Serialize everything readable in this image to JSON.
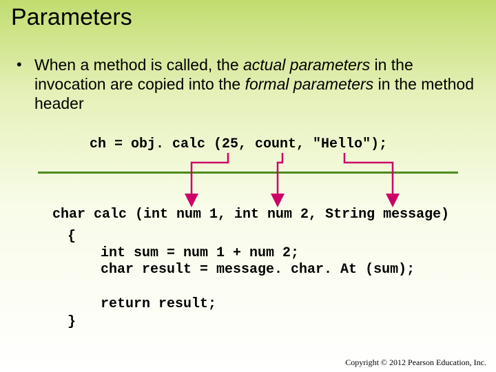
{
  "title": "Parameters",
  "bullet": {
    "pre": "When a method is called, the ",
    "it1": "actual parameters",
    "mid": " in the invocation are copied into the ",
    "it2": "formal parameters",
    "post": " in the method header"
  },
  "code": {
    "call": "ch = obj. calc (25, count, \"Hello\");",
    "sig": "char calc (int num 1, int num 2, String message)",
    "brace_open": "{",
    "line1": "int sum = num 1 + num 2;",
    "line2": "char result = message. char. At (sum);",
    "ret": "return result;",
    "brace_close": "}"
  },
  "footer": "Copyright © 2012 Pearson Education, Inc."
}
